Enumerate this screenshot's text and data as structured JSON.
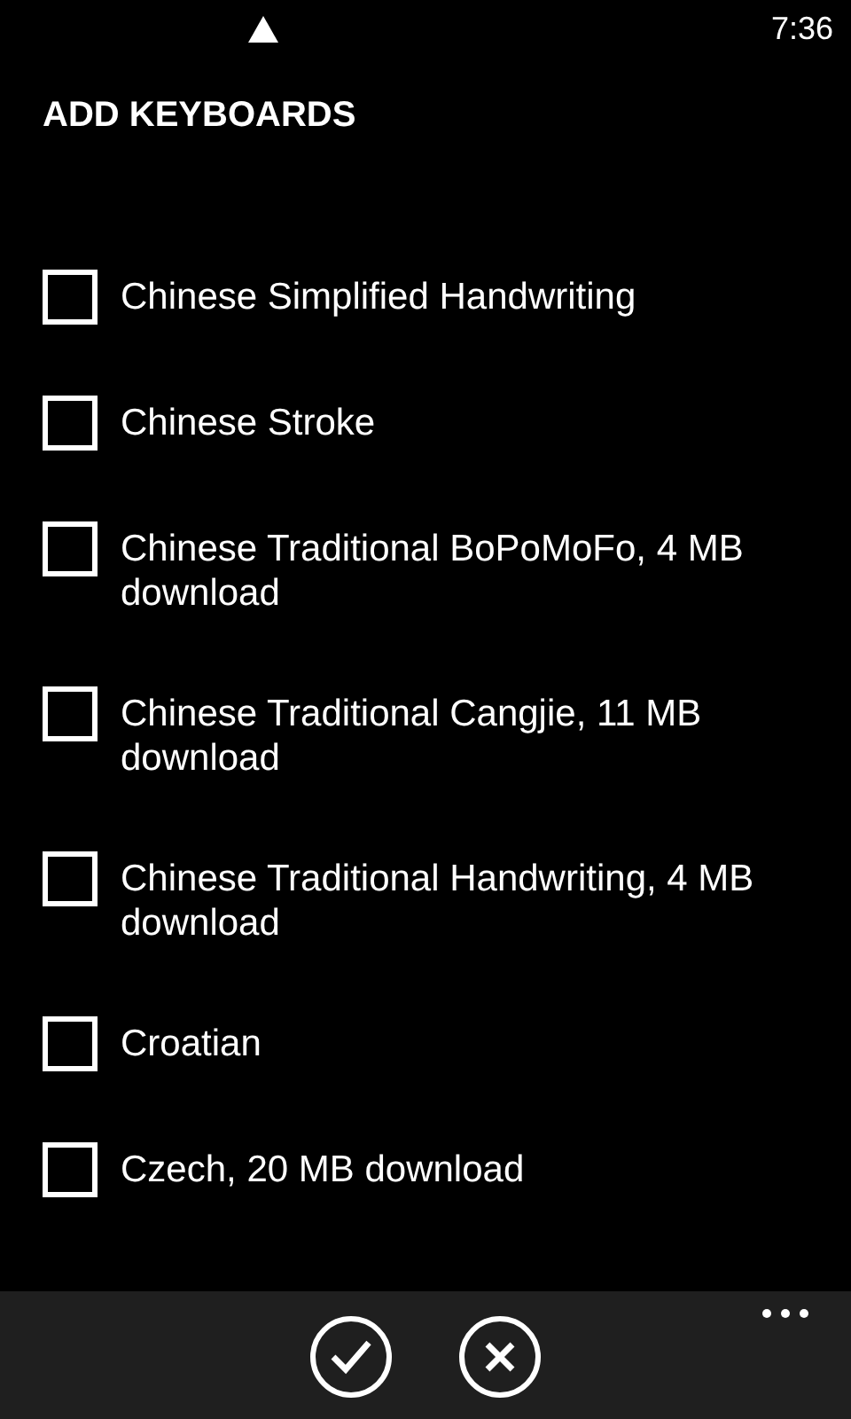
{
  "status_bar": {
    "time": "7:36"
  },
  "title": "ADD KEYBOARDS",
  "keyboards": [
    {
      "label": "Chinese Simplified Handwriting",
      "checked": false
    },
    {
      "label": "Chinese Stroke",
      "checked": false
    },
    {
      "label": "Chinese Traditional BoPoMoFo, 4 MB download",
      "checked": false
    },
    {
      "label": "Chinese Traditional Cangjie, 11 MB download",
      "checked": false
    },
    {
      "label": "Chinese Traditional Handwriting, 4 MB download",
      "checked": false
    },
    {
      "label": "Croatian",
      "checked": false
    },
    {
      "label": "Czech, 20 MB download",
      "checked": false
    }
  ]
}
